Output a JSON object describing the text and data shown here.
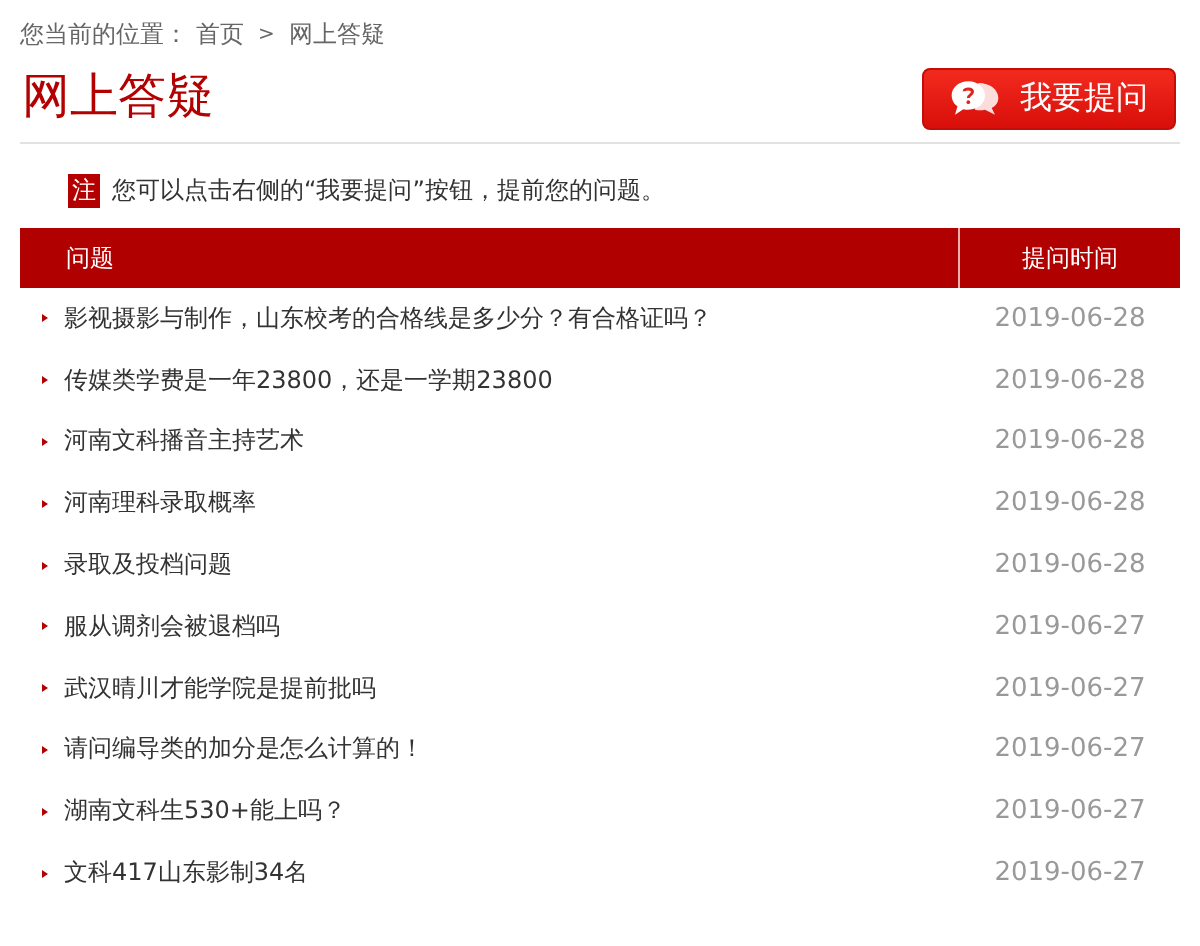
{
  "breadcrumb": {
    "label": "您当前的位置：",
    "links": [
      "首页"
    ],
    "separator": ">",
    "current": "网上答疑"
  },
  "title": "网上答疑",
  "ask_button": {
    "label": "我要提问"
  },
  "note": {
    "badge": "注",
    "text": "您可以点击右侧的“我要提问”按钮，提前您的问题。"
  },
  "table": {
    "columns": [
      "问题",
      "提问时间"
    ],
    "rows": [
      {
        "question": "影视摄影与制作，山东校考的合格线是多少分？有合格证吗？",
        "date": "2019-06-28"
      },
      {
        "question": "传媒类学费是一年23800，还是一学期23800",
        "date": "2019-06-28"
      },
      {
        "question": "河南文科播音主持艺术",
        "date": "2019-06-28"
      },
      {
        "question": "河南理科录取概率",
        "date": "2019-06-28"
      },
      {
        "question": "录取及投档问题",
        "date": "2019-06-28"
      },
      {
        "question": "服从调剂会被退档吗",
        "date": "2019-06-27"
      },
      {
        "question": "武汉晴川才能学院是提前批吗",
        "date": "2019-06-27"
      },
      {
        "question": "请问编导类的加分是怎么计算的！",
        "date": "2019-06-27"
      },
      {
        "question": "湖南文科生530+能上吗？",
        "date": "2019-06-27"
      },
      {
        "question": "文科417山东影制34名",
        "date": "2019-06-27"
      }
    ]
  }
}
